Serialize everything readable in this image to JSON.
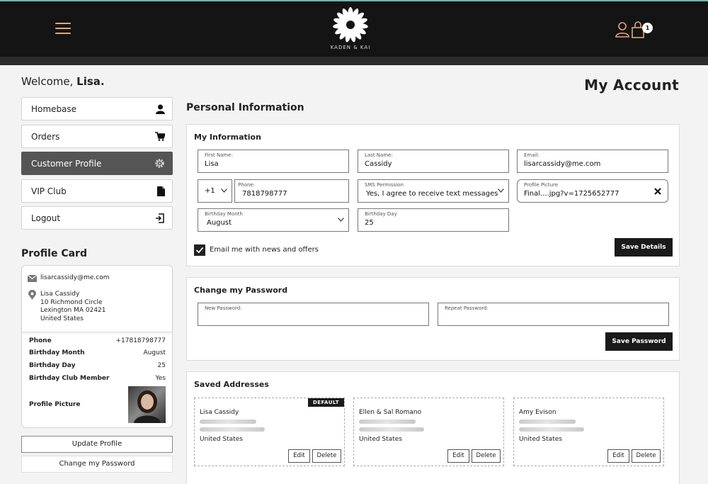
{
  "header": {
    "brand": "KADEN & KAI",
    "cart_count": "1"
  },
  "welcome": {
    "prefix": "Welcome, ",
    "name": "Lisa."
  },
  "sidebar": {
    "items": [
      {
        "label": "Homebase",
        "icon": "user-icon"
      },
      {
        "label": "Orders",
        "icon": "cart-icon"
      },
      {
        "label": "Customer Profile",
        "icon": "gear-icon"
      },
      {
        "label": "VIP Club",
        "icon": "document-icon"
      },
      {
        "label": "Logout",
        "icon": "logout-icon"
      }
    ],
    "active_index": 2
  },
  "profile_card": {
    "title": "Profile Card",
    "email": "lisarcassidy@me.com",
    "address_lines": [
      "Lisa Cassidy",
      "10 Richmond Circle",
      "Lexington MA 02421",
      "United States"
    ],
    "rows": [
      {
        "key": "Phone",
        "value": "+17818798777"
      },
      {
        "key": "Birthday Month",
        "value": "August"
      },
      {
        "key": "Birthday Day",
        "value": "25"
      },
      {
        "key": "Birthday Club Member",
        "value": "Yes"
      },
      {
        "key": "Profile Picture",
        "value": ""
      }
    ],
    "update_button": "Update Profile",
    "change_password_button": "Change my Password"
  },
  "main": {
    "page_title": "My Account",
    "section_title": "Personal Information",
    "my_info": {
      "title": "My Information",
      "first_name": {
        "label": "First Name:",
        "value": "Lisa"
      },
      "last_name": {
        "label": "Last Name:",
        "value": "Cassidy"
      },
      "email": {
        "label": "Email:",
        "value": "lisarcassidy@me.com"
      },
      "country_code": "+1",
      "phone": {
        "label": "Phone:",
        "value": "7818798777"
      },
      "sms": {
        "label": "SMS Permission",
        "value": "Yes, I agree to receive text messages"
      },
      "profile_picture": {
        "label": "Profile Picture",
        "value": "Final....jpg?v=1725652777"
      },
      "birthday_month": {
        "label": "Birthday Month",
        "value": "August"
      },
      "birthday_day": {
        "label": "Birthday Day",
        "value": "25"
      },
      "email_opt_in": "Email me with news and offers",
      "email_opt_in_checked": true,
      "save_button": "Save Details"
    },
    "password": {
      "title": "Change my Password",
      "new_label": "New Password:",
      "repeat_label": "Repeat Password:",
      "save_button": "Save Password"
    },
    "addresses": {
      "title": "Saved Addresses",
      "default_badge": "DEFAULT",
      "edit_label": "Edit",
      "delete_label": "Delete",
      "items": [
        {
          "name": "Lisa Cassidy",
          "country": "United States",
          "is_default": true
        },
        {
          "name": "Ellen & Sal Romano",
          "country": "United States",
          "is_default": false
        },
        {
          "name": "Amy Evison",
          "country": "United States",
          "is_default": false
        }
      ]
    }
  }
}
